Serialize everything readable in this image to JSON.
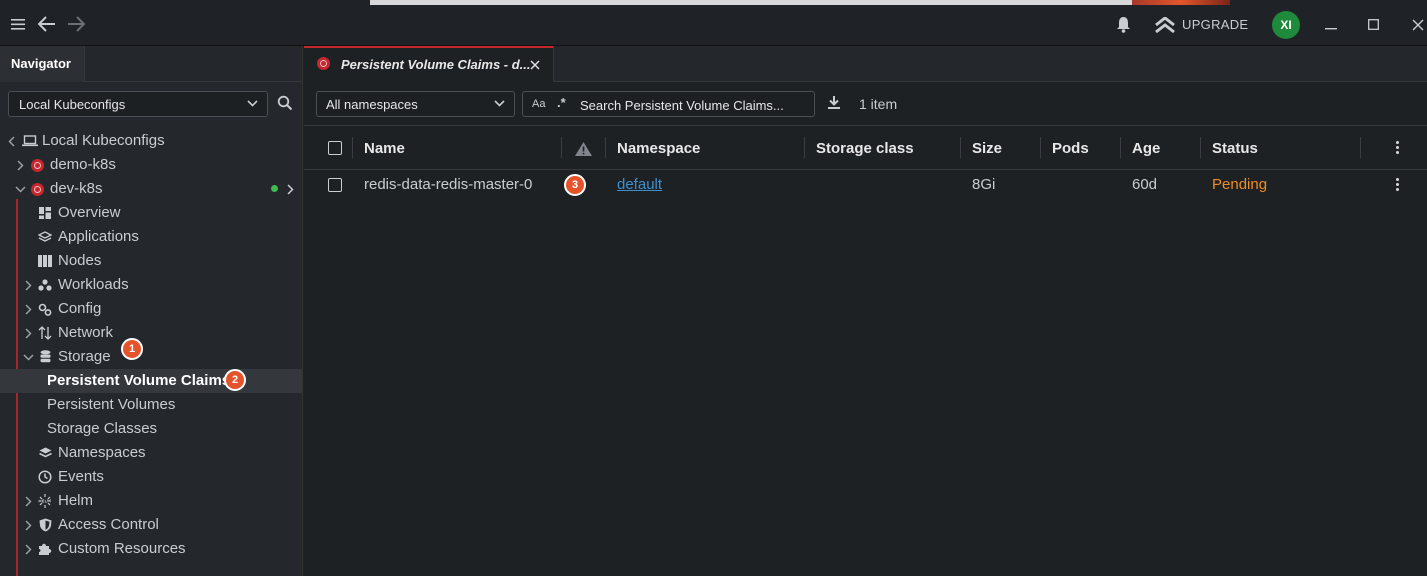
{
  "titlebar": {
    "upgrade_label": "UPGRADE",
    "avatar_initials": "XI"
  },
  "navigator": {
    "tab_label": "Navigator",
    "kubeconfig_select": "Local Kubeconfigs",
    "tree": {
      "root": "Local Kubeconfigs",
      "clusters": [
        "demo-k8s",
        "dev-k8s"
      ],
      "items": [
        "Overview",
        "Applications",
        "Nodes",
        "Workloads",
        "Config",
        "Network",
        "Storage",
        "Persistent Volume Claims",
        "Persistent Volumes",
        "Storage Classes",
        "Namespaces",
        "Events",
        "Helm",
        "Access Control",
        "Custom Resources"
      ]
    }
  },
  "badges": [
    "1",
    "2",
    "3"
  ],
  "main": {
    "tab_label": "Persistent Volume Claims - d...",
    "namespace_select": "All namespaces",
    "search_placeholder": "Search Persistent Volume Claims...",
    "search_case_label": "Aa",
    "search_regex_label": ".*",
    "item_count": "1 item",
    "columns": [
      "Name",
      "Namespace",
      "Storage class",
      "Size",
      "Pods",
      "Age",
      "Status"
    ],
    "rows": [
      {
        "name": "redis-data-redis-master-0",
        "namespace": "default",
        "storage_class": "",
        "size": "8Gi",
        "pods": "",
        "age": "60d",
        "status": "Pending"
      }
    ]
  },
  "colors": {
    "accent": "#c3282e",
    "badge": "#e4532c",
    "link": "#3d90ce",
    "pending": "#ee8c26",
    "avatar": "#1f8a3b",
    "connected": "#3fb950"
  },
  "icons": [
    "hamburger-icon",
    "back-arrow-icon",
    "forward-arrow-icon",
    "bell-icon",
    "upgrade-icon",
    "minimize-icon",
    "maximize-icon",
    "close-icon",
    "search-icon",
    "kubernetes-icon",
    "download-icon",
    "warning-icon",
    "kebab-menu-icon"
  ]
}
